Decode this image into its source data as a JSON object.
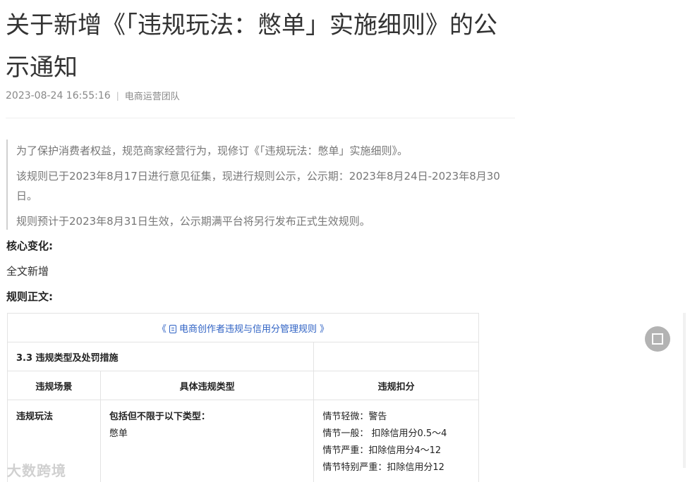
{
  "article": {
    "title": "关于新增《「违规玩法：憋单」实施细则》的公示通知",
    "datetime": "2023-08-24 16:55:16",
    "separator": "|",
    "author": "电商运营团队"
  },
  "notice": {
    "p1": "为了保护消费者权益，规范商家经营行为，现修订《「违规玩法：憋单」实施细则》。",
    "p2": "该规则已于2023年8月17日进行意见征集，现进行规则公示，公示期：2023年8月24日-2023年8月30日。",
    "p3": "规则预计于2023年8月31日生效，公示期满平台将另行发布正式生效规则。"
  },
  "core_change": {
    "heading": "核心变化:",
    "text": "全文新增"
  },
  "rules": {
    "heading": "规则正文:",
    "table": {
      "link_prefix": "《",
      "link_text": "电商创作者违规与信用分管理规则",
      "link_suffix": "》",
      "section": "3.3 违规类型及处罚措施",
      "headers": [
        "违规场景",
        "具体违规类型",
        "违规扣分"
      ],
      "row": {
        "scene": "违规玩法",
        "type_lead": "包括但不限于以下类型：",
        "type_item": "憋单",
        "penalties": [
          "情节轻微：警告",
          "情节一般： 扣除信用分0.5～4",
          "情节严重：扣除信用分4～12",
          "情节特别严重：扣除信用分12"
        ]
      }
    }
  },
  "watermark": "大数跨境",
  "icons": {
    "link_doc": "document-icon",
    "fullscreen": "fullscreen-icon"
  }
}
